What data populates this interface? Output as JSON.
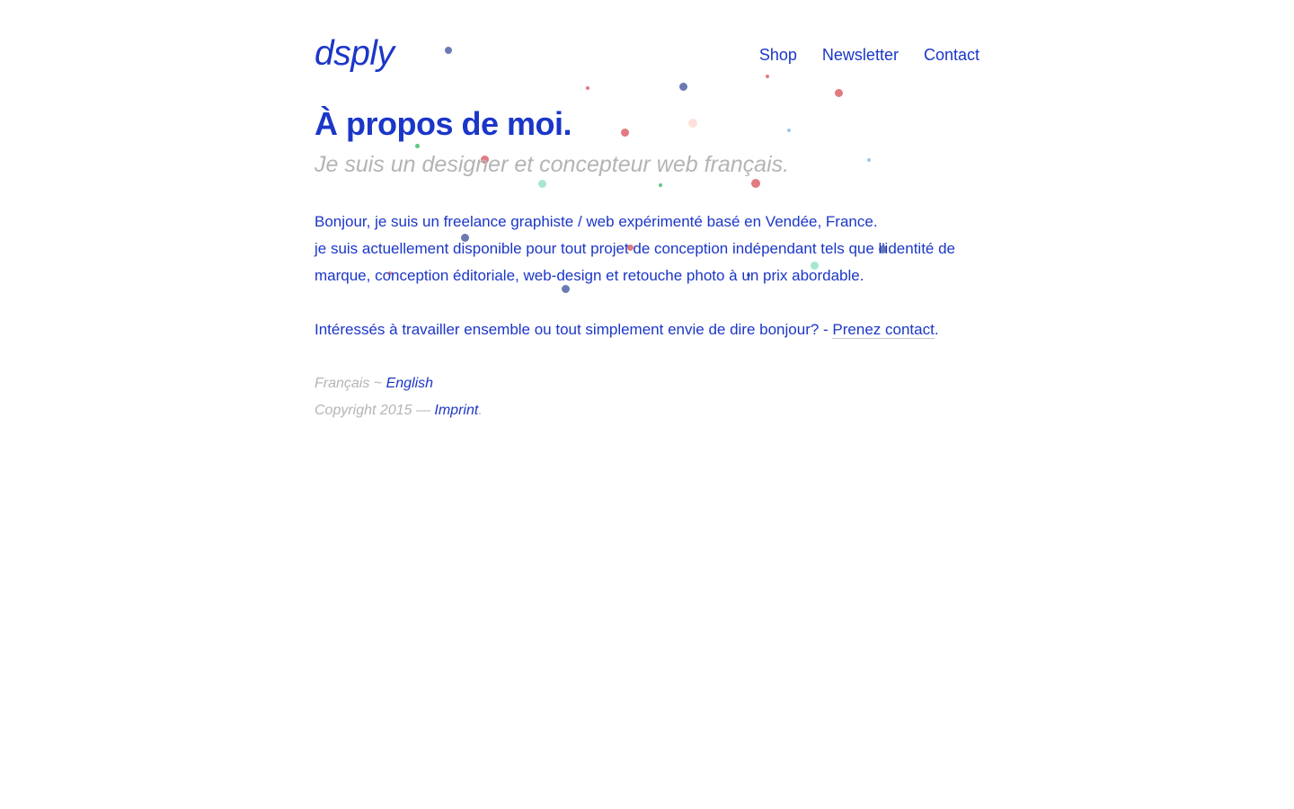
{
  "header": {
    "logo": "dsply",
    "nav": [
      "Shop",
      "Newsletter",
      "Contact"
    ]
  },
  "main": {
    "title": "À propos de moi.",
    "subtitle": "Je suis un designer et concepteur web français.",
    "bio_line1": "Bonjour, je suis un freelance graphiste / web expérimenté basé en Vendée, France.",
    "bio_line2": "je suis actuellement disponible pour tout projet de conception indépendant tels que l'identité de marque, conception éditoriale, web-design et retouche photo à un prix abordable.",
    "contact_prefix": "Intéressés à travailler ensemble ou tout simplement envie de dire bonjour? - ",
    "contact_link": "Prenez contact",
    "contact_suffix": "."
  },
  "footer": {
    "lang_current": "Français",
    "lang_sep": " ~ ",
    "lang_other": "English",
    "copyright": "Copyright 2015 — ",
    "imprint": "Imprint",
    "imprint_suffix": "."
  },
  "colors": {
    "accent": "#1b36c8",
    "muted": "#b4b4b4",
    "background": "#ffffff",
    "dot_red": "#e27a82",
    "dot_navy": "#6b7ab2",
    "dot_mint": "#a6e8cf",
    "dot_green": "#5cc97b",
    "dot_lightblue": "#9dc7f0",
    "dot_peach": "#fde0dc"
  }
}
